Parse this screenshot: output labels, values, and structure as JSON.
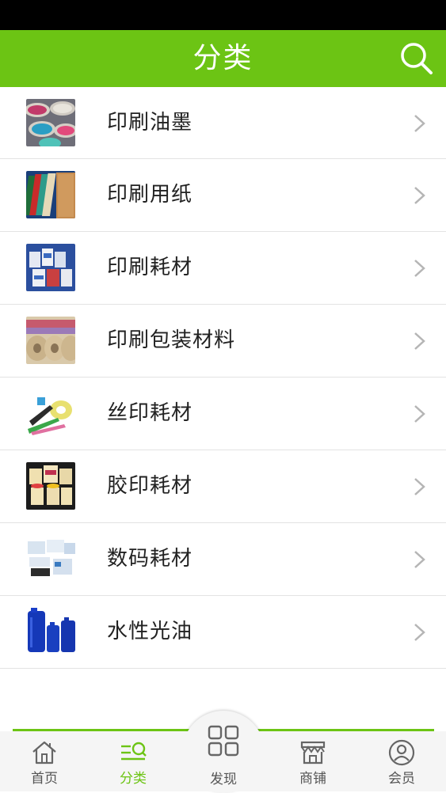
{
  "header": {
    "title": "分类",
    "search_icon": "search-icon"
  },
  "colors": {
    "accent": "#6cc414",
    "text": "#222222",
    "tab_text": "#555555",
    "divider": "#e3e3e3"
  },
  "categories": [
    {
      "label": "印刷油墨",
      "thumb": "ink-cans"
    },
    {
      "label": "印刷用纸",
      "thumb": "paper-sheets"
    },
    {
      "label": "印刷耗材",
      "thumb": "consumables-cans"
    },
    {
      "label": "印刷包装材料",
      "thumb": "packaging-rolls"
    },
    {
      "label": "丝印耗材",
      "thumb": "screen-print-tools"
    },
    {
      "label": "胶印耗材",
      "thumb": "offset-ink-cans"
    },
    {
      "label": "数码耗材",
      "thumb": "digital-cartridges"
    },
    {
      "label": "水性光油",
      "thumb": "blue-barrels"
    }
  ],
  "tabbar": {
    "tabs": [
      {
        "label": "首页",
        "icon": "home-icon",
        "active": false
      },
      {
        "label": "分类",
        "icon": "category-icon",
        "active": true
      },
      {
        "label": "发现",
        "icon": "grid-icon",
        "active": false
      },
      {
        "label": "商铺",
        "icon": "store-icon",
        "active": false
      },
      {
        "label": "会员",
        "icon": "user-icon",
        "active": false
      }
    ]
  }
}
